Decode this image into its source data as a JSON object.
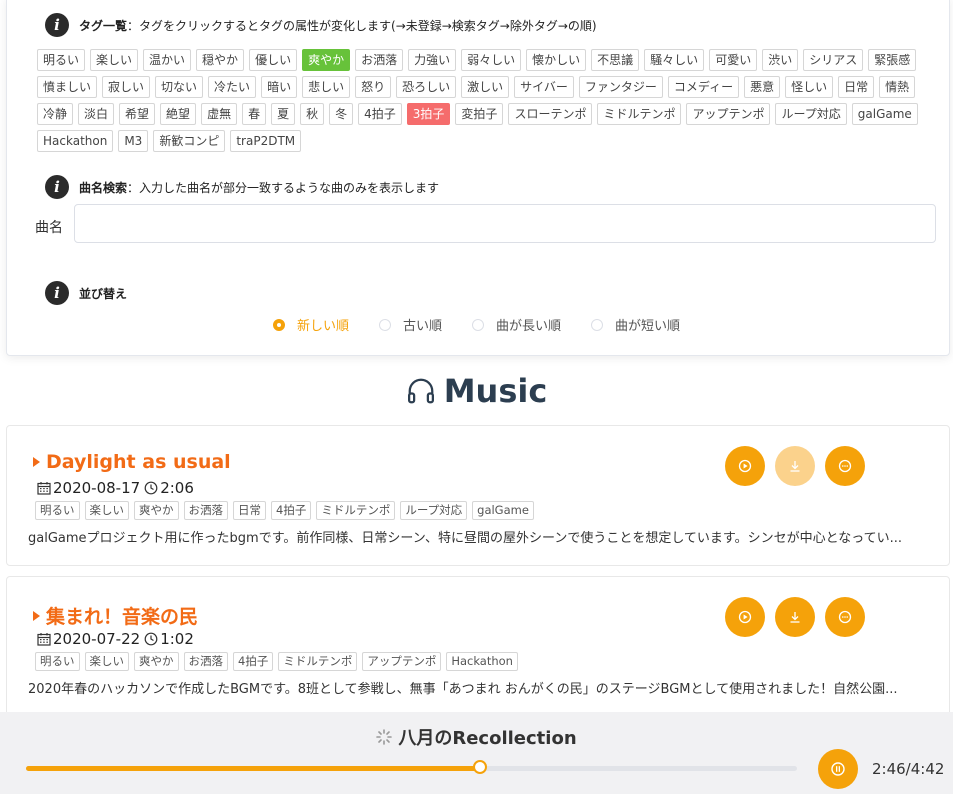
{
  "filter": {
    "tag_section": {
      "title": "タグ一覧",
      "description": "：タグをクリックするとタグの属性が変化します(→未登録→検索タグ→除外タグ→の順)"
    },
    "tags": [
      {
        "label": "明るい",
        "state": "none"
      },
      {
        "label": "楽しい",
        "state": "none"
      },
      {
        "label": "温かい",
        "state": "none"
      },
      {
        "label": "穏やか",
        "state": "none"
      },
      {
        "label": "優しい",
        "state": "none"
      },
      {
        "label": "爽やか",
        "state": "search"
      },
      {
        "label": "お洒落",
        "state": "none"
      },
      {
        "label": "力強い",
        "state": "none"
      },
      {
        "label": "弱々しい",
        "state": "none"
      },
      {
        "label": "懐かしい",
        "state": "none"
      },
      {
        "label": "不思議",
        "state": "none"
      },
      {
        "label": "騒々しい",
        "state": "none"
      },
      {
        "label": "可愛い",
        "state": "none"
      },
      {
        "label": "渋い",
        "state": "none"
      },
      {
        "label": "シリアス",
        "state": "none"
      },
      {
        "label": "緊張感",
        "state": "none"
      },
      {
        "label": "憤ましい",
        "state": "none"
      },
      {
        "label": "寂しい",
        "state": "none"
      },
      {
        "label": "切ない",
        "state": "none"
      },
      {
        "label": "冷たい",
        "state": "none"
      },
      {
        "label": "暗い",
        "state": "none"
      },
      {
        "label": "悲しい",
        "state": "none"
      },
      {
        "label": "怒り",
        "state": "none"
      },
      {
        "label": "恐ろしい",
        "state": "none"
      },
      {
        "label": "激しい",
        "state": "none"
      },
      {
        "label": "サイバー",
        "state": "none"
      },
      {
        "label": "ファンタジー",
        "state": "none"
      },
      {
        "label": "コメディー",
        "state": "none"
      },
      {
        "label": "悪意",
        "state": "none"
      },
      {
        "label": "怪しい",
        "state": "none"
      },
      {
        "label": "日常",
        "state": "none"
      },
      {
        "label": "情熱",
        "state": "none"
      },
      {
        "label": "冷静",
        "state": "none"
      },
      {
        "label": "淡白",
        "state": "none"
      },
      {
        "label": "希望",
        "state": "none"
      },
      {
        "label": "絶望",
        "state": "none"
      },
      {
        "label": "虚無",
        "state": "none"
      },
      {
        "label": "春",
        "state": "none"
      },
      {
        "label": "夏",
        "state": "none"
      },
      {
        "label": "秋",
        "state": "none"
      },
      {
        "label": "冬",
        "state": "none"
      },
      {
        "label": "4拍子",
        "state": "none"
      },
      {
        "label": "3拍子",
        "state": "exclude"
      },
      {
        "label": "変拍子",
        "state": "none"
      },
      {
        "label": "スローテンポ",
        "state": "none"
      },
      {
        "label": "ミドルテンポ",
        "state": "none"
      },
      {
        "label": "アップテンポ",
        "state": "none"
      },
      {
        "label": "ループ対応",
        "state": "none"
      },
      {
        "label": "galGame",
        "state": "none"
      },
      {
        "label": "Hackathon",
        "state": "none"
      },
      {
        "label": "M3",
        "state": "none"
      },
      {
        "label": "新歓コンピ",
        "state": "none"
      },
      {
        "label": "traP2DTM",
        "state": "none"
      }
    ],
    "name_search": {
      "title": "曲名検索",
      "description": "：入力した曲名が部分一致するような曲のみを表示します",
      "field_label": "曲名",
      "value": "",
      "placeholder": ""
    },
    "sort": {
      "title": "並び替え",
      "options": [
        "新しい順",
        "古い順",
        "曲が長い順",
        "曲が短い順"
      ],
      "selected": "新しい順"
    }
  },
  "music_heading": {
    "title": "Music",
    "icon": "headphones-icon"
  },
  "songs": [
    {
      "title": "Daylight as usual",
      "date": "2020-08-17",
      "duration": "2:06",
      "tags": [
        "明るい",
        "楽しい",
        "爽やか",
        "お洒落",
        "日常",
        "4拍子",
        "ミドルテンポ",
        "ループ対応",
        "galGame"
      ],
      "description": "galGameプロジェクト用に作ったbgmです。前作同様、日常シーン、特に昼間の屋外シーンで使うことを想定しています。シンセが中心となってい...",
      "download_enabled": false
    },
    {
      "title": "集まれ！音楽の民",
      "date": "2020-07-22",
      "duration": "1:02",
      "tags": [
        "明るい",
        "楽しい",
        "爽やか",
        "お洒落",
        "4拍子",
        "ミドルテンポ",
        "アップテンポ",
        "Hackathon"
      ],
      "description": "2020年春のハッカソンで作成したBGMです。8班として参戦し、無事「あつまれ おんがくの民」のステージBGMとして使用されました！自然公園...",
      "download_enabled": true
    }
  ],
  "player": {
    "title": "八月のRecollection",
    "current": "2:46",
    "total": "4:42",
    "time_display": "2:46/4:42",
    "progress": 0.589
  },
  "colors": {
    "accent": "#f5a20a",
    "title_orange": "#f26b16",
    "search_tag": "#67c23a",
    "exclude_tag": "#f56c6c"
  }
}
